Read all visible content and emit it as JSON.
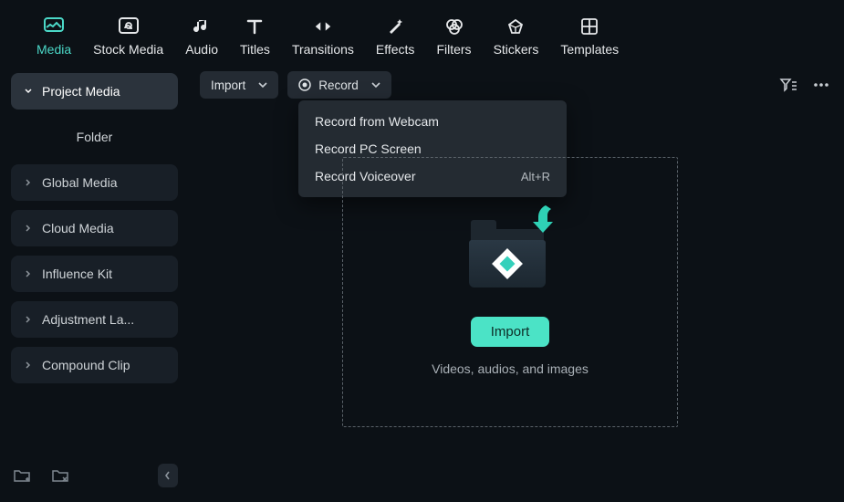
{
  "tabs": [
    {
      "id": "media",
      "label": "Media",
      "active": true
    },
    {
      "id": "stock-media",
      "label": "Stock Media"
    },
    {
      "id": "audio",
      "label": "Audio"
    },
    {
      "id": "titles",
      "label": "Titles"
    },
    {
      "id": "transitions",
      "label": "Transitions"
    },
    {
      "id": "effects",
      "label": "Effects"
    },
    {
      "id": "filters",
      "label": "Filters"
    },
    {
      "id": "stickers",
      "label": "Stickers"
    },
    {
      "id": "templates",
      "label": "Templates"
    }
  ],
  "sidebar": {
    "items": [
      {
        "label": "Project Media",
        "active": true,
        "expander": "down"
      },
      {
        "label": "Folder",
        "folder": true
      },
      {
        "label": "Global Media",
        "expander": "right"
      },
      {
        "label": "Cloud Media",
        "expander": "right"
      },
      {
        "label": "Influence Kit",
        "expander": "right"
      },
      {
        "label": "Adjustment La...",
        "expander": "right"
      },
      {
        "label": "Compound Clip",
        "expander": "right"
      }
    ]
  },
  "toolbar": {
    "import_label": "Import",
    "record_label": "Record"
  },
  "record_menu": {
    "items": [
      {
        "label": "Record from Webcam",
        "shortcut": ""
      },
      {
        "label": "Record PC Screen",
        "shortcut": ""
      },
      {
        "label": "Record Voiceover",
        "shortcut": "Alt+R"
      }
    ]
  },
  "dropzone": {
    "cta_label": "Import",
    "hint": "Videos, audios, and images"
  },
  "colors": {
    "accent": "#4bd8c7",
    "bg": "#0c1116"
  }
}
